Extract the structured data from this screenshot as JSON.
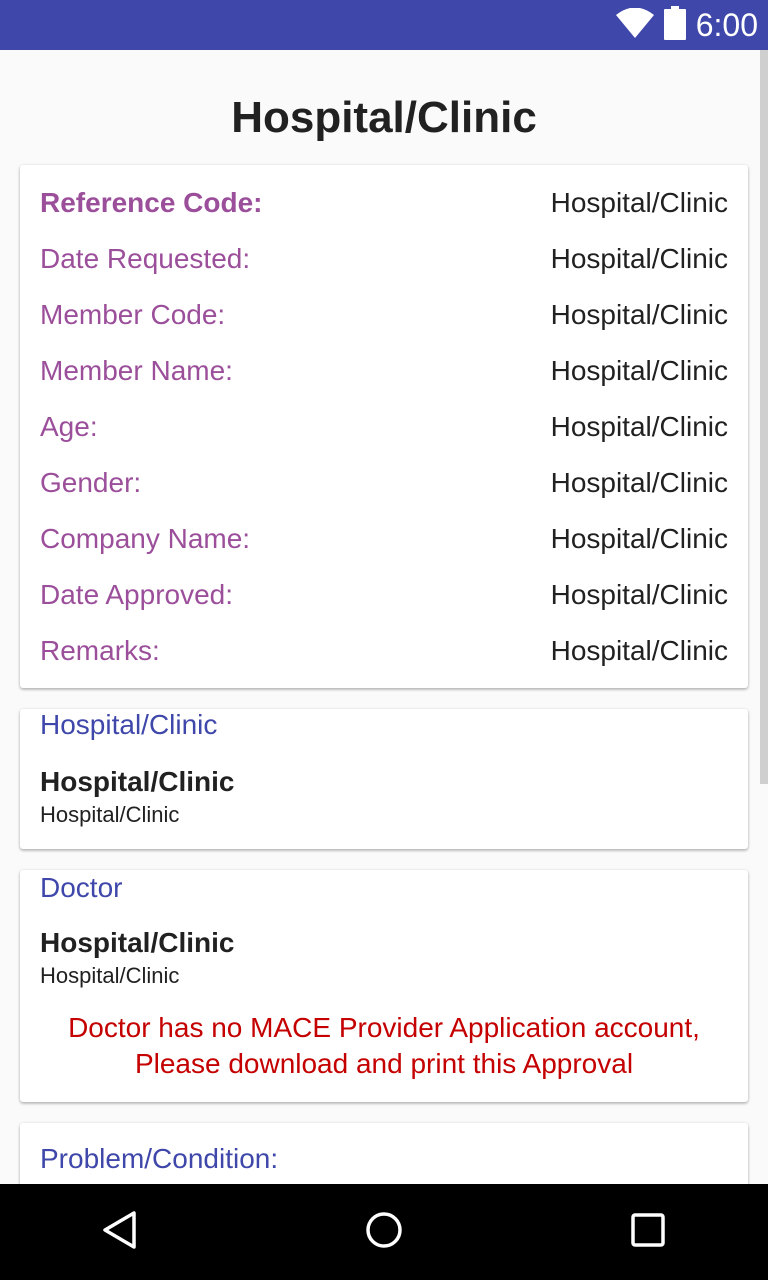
{
  "status_bar": {
    "time": "6:00",
    "icons": [
      "wifi-icon",
      "battery-icon"
    ]
  },
  "page": {
    "title": "Hospital/Clinic"
  },
  "info_card": {
    "rows": [
      {
        "label": "Reference Code:",
        "value": "Hospital/Clinic",
        "bold": true
      },
      {
        "label": "Date Requested:",
        "value": "Hospital/Clinic"
      },
      {
        "label": "Member Code:",
        "value": "Hospital/Clinic"
      },
      {
        "label": "Member Name:",
        "value": "Hospital/Clinic"
      },
      {
        "label": "Age:",
        "value": "Hospital/Clinic"
      },
      {
        "label": "Gender:",
        "value": "Hospital/Clinic"
      },
      {
        "label": "Company Name:",
        "value": "Hospital/Clinic"
      },
      {
        "label": "Date Approved:",
        "value": "Hospital/Clinic"
      },
      {
        "label": "Remarks:",
        "value": "Hospital/Clinic"
      }
    ]
  },
  "hospital_card": {
    "heading": "Hospital/Clinic",
    "name": "Hospital/Clinic",
    "sub": "Hospital/Clinic"
  },
  "doctor_card": {
    "heading": "Doctor",
    "name": "Hospital/Clinic",
    "sub": "Hospital/Clinic",
    "warning_line1": "Doctor has no MACE Provider Application account,",
    "warning_line2": "Please download and print this Approval"
  },
  "problem_card": {
    "heading": "Problem/Condition:"
  },
  "nav_bar": {
    "buttons": [
      "back-icon",
      "home-icon",
      "recents-icon"
    ]
  },
  "colors": {
    "primary": "#3f48aa",
    "label": "#9b4f9a",
    "warning": "#c40000"
  }
}
